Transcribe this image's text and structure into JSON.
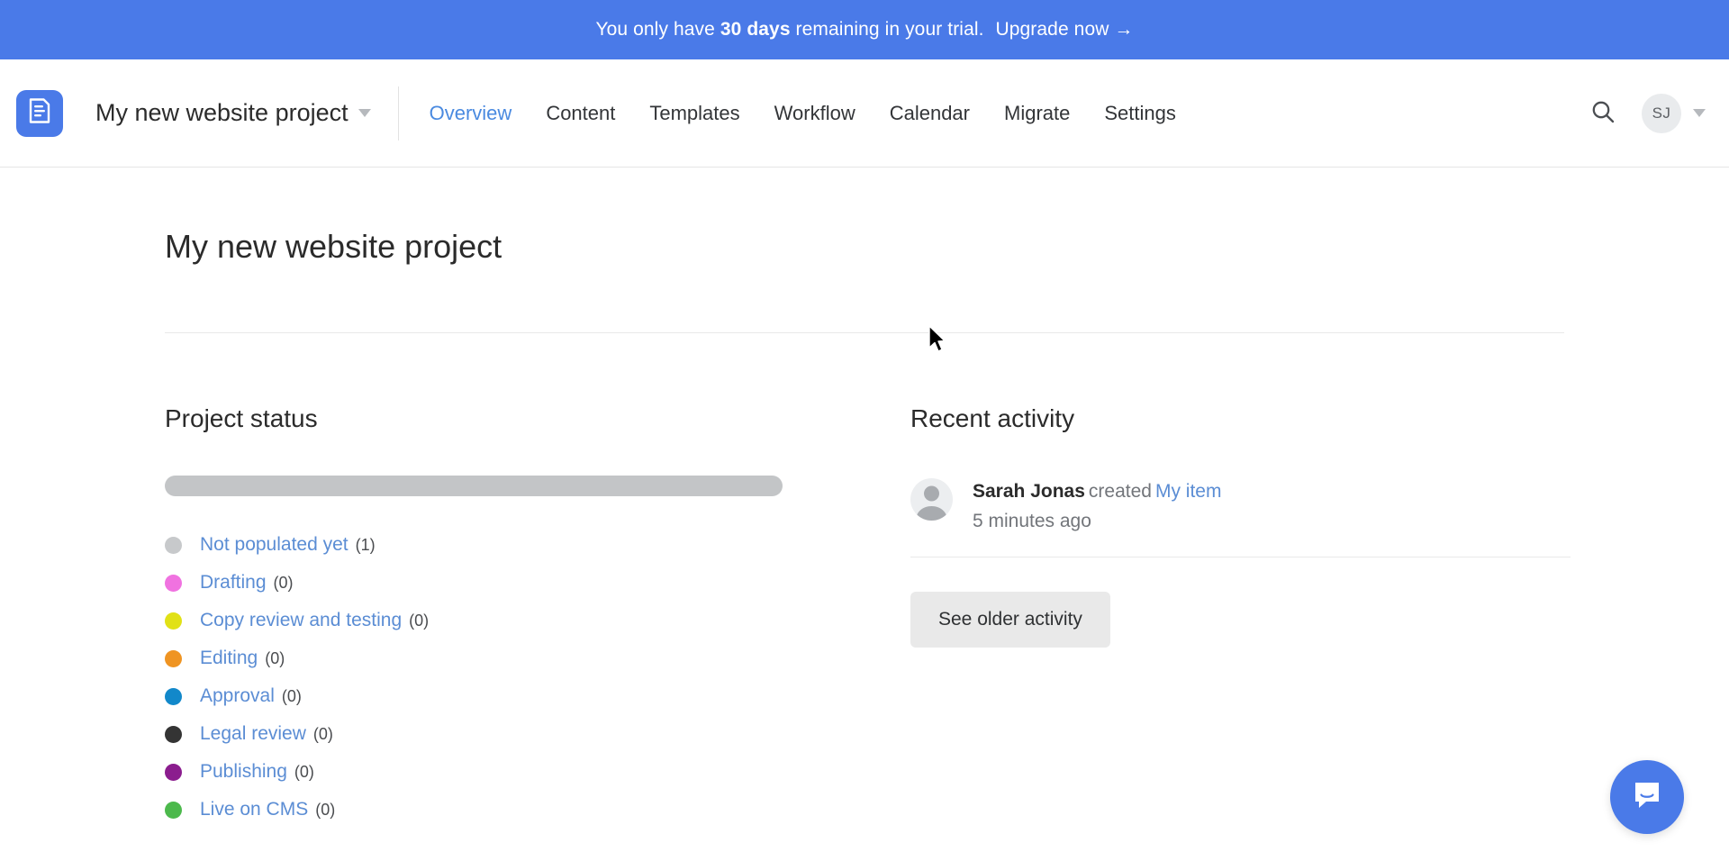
{
  "banner": {
    "prefix": "You only have ",
    "days": "30 days",
    "middle": " remaining in your trial. ",
    "upgrade": "Upgrade now →"
  },
  "header": {
    "logo_icon": "document-logo-icon",
    "project_name": "My new website project",
    "project_caret_icon": "chevron-down-icon",
    "nav": [
      {
        "label": "Overview",
        "active": true
      },
      {
        "label": "Content",
        "active": false
      },
      {
        "label": "Templates",
        "active": false
      },
      {
        "label": "Workflow",
        "active": false
      },
      {
        "label": "Calendar",
        "active": false
      },
      {
        "label": "Migrate",
        "active": false
      },
      {
        "label": "Settings",
        "active": false
      }
    ],
    "search_icon": "search-icon",
    "avatar_initials": "SJ",
    "account_caret_icon": "chevron-down-icon"
  },
  "page": {
    "title": "My new website project"
  },
  "project_status": {
    "heading": "Project status",
    "progress_percent": 100,
    "progress_color": "#c3c5c7",
    "statuses": [
      {
        "label": "Not populated yet",
        "count": "(1)",
        "color": "#c7c9cb"
      },
      {
        "label": "Drafting",
        "count": "(0)",
        "color": "#f072e0"
      },
      {
        "label": "Copy review and testing",
        "count": "(0)",
        "color": "#e1e116"
      },
      {
        "label": "Editing",
        "count": "(0)",
        "color": "#ef9422"
      },
      {
        "label": "Approval",
        "count": "(0)",
        "color": "#1288ca"
      },
      {
        "label": "Legal review",
        "count": "(0)",
        "color": "#343434"
      },
      {
        "label": "Publishing",
        "count": "(0)",
        "color": "#8b1d8e"
      },
      {
        "label": "Live on CMS",
        "count": "(0)",
        "color": "#4cb94c"
      }
    ]
  },
  "recent_activity": {
    "heading": "Recent activity",
    "items": [
      {
        "avatar_icon": "user-placeholder-avatar",
        "user": "Sarah Jonas",
        "verb": "created",
        "target": "My item",
        "time": "5 minutes ago"
      }
    ],
    "see_older_label": "See older activity"
  },
  "intercom": {
    "icon": "chat-bubble-icon"
  }
}
